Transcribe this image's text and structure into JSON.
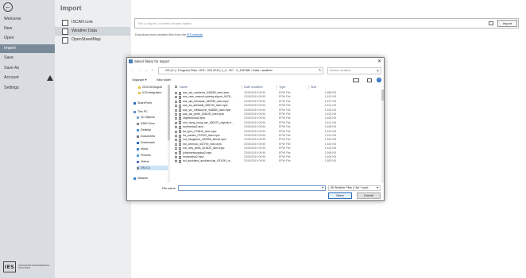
{
  "leftnav": {
    "items": [
      {
        "label": "Welcome"
      },
      {
        "label": "New"
      },
      {
        "label": "Open"
      },
      {
        "label": "Import"
      },
      {
        "label": "Save"
      },
      {
        "label": "Save As"
      },
      {
        "label": "Account"
      },
      {
        "label": "Settings"
      }
    ],
    "active": "Import",
    "logo_mark": "IES",
    "logo_text": "INTEGRATED ENVIRONMENTAL SOLUTIONS"
  },
  "page": {
    "title": "Import",
    "subnav": [
      {
        "label": "ISCAN Link"
      },
      {
        "label": "Weather Data"
      },
      {
        "label": "OpenStreetMap"
      }
    ],
    "path_placeholder": "File to import, or select browse button",
    "import_label": "Import",
    "download_prefix": "Download more weather files from the ",
    "download_link": "IES website"
  },
  "dialog": {
    "title": "Select file(s) for import",
    "address": "OS (C:)  ›  Program Files  ›  IES  ›  IVN 2019_1_0 - RC - 0_15278B  ›  Data  ›  weather",
    "search_placeholder": "Search weather",
    "organize_label": "Organize ▾",
    "new_folder_label": "New folder",
    "tree": [
      {
        "label": "2019-08 August"
      },
      {
        "label": "ICM integration"
      },
      {
        "label": "SharePoint"
      },
      {
        "label": "This PC"
      },
      {
        "label": "3D Objects"
      },
      {
        "label": "A380 Drive"
      },
      {
        "label": "Desktop"
      },
      {
        "label": "Documents"
      },
      {
        "label": "Downloads"
      },
      {
        "label": "Music"
      },
      {
        "label": "Pictures"
      },
      {
        "label": "Videos"
      },
      {
        "label": "OS (C:)"
      },
      {
        "label": "Network"
      }
    ],
    "columns": {
      "name": "Name",
      "date": "Date modified",
      "type": "Type",
      "size": "Size"
    },
    "files": [
      {
        "name": "aus_act_canberra_946260_iwec.epw",
        "date": "23/05/2019 09:50",
        "type": "EPW File",
        "size": "1,588 KB"
      },
      {
        "name": "aus_nsw_mascot-sydney.airport_9478...",
        "date": "23/05/2019 09:50",
        "type": "EPW File",
        "size": "1,610 KB"
      },
      {
        "name": "aus_qld_brisbane_945780_iwec.epw",
        "date": "23/05/2019 09:50",
        "type": "EPW File",
        "size": "1,537 KB"
      },
      {
        "name": "aus_sa_adelaide_946720_iwec.epw",
        "date": "23/05/2019 09:50",
        "type": "EPW File",
        "size": "1,514 KB"
      },
      {
        "name": "aus_vic_melbourne_948680_iwec.epw",
        "date": "23/05/2019 09:50",
        "type": "EPW File",
        "size": "1,534 KB"
      },
      {
        "name": "aus_wa_perth_946100_iwec.epw",
        "date": "23/05/2019 09:50",
        "type": "EPW File",
        "size": "1,523 KB"
      },
      {
        "name": "capetownsa2.epw",
        "date": "23/05/2019 09:50",
        "type": "EPW File",
        "size": "1,608 KB"
      },
      {
        "name": "chn_hong_kong_sar_450070_cityuhk.e...",
        "date": "23/05/2019 09:50",
        "type": "EPW File",
        "size": "1,631 KB"
      },
      {
        "name": "dunbardsa2.epw",
        "date": "23/05/2019 09:50",
        "type": "EPW File",
        "size": "1,598 KB"
      },
      {
        "name": "fra_lyon_074810_iwec.epw",
        "date": "23/05/2019 09:50",
        "type": "EPW File",
        "size": "1,510 KB"
      },
      {
        "name": "fra_nantes_072220_iwec.epw",
        "date": "23/05/2019 09:50",
        "type": "EPW File",
        "size": "1,510 KB"
      },
      {
        "name": "ind_bangalore_432950_ishrae.epw",
        "date": "23/05/2019 09:50",
        "type": "EPW File",
        "size": "1,543 KB"
      },
      {
        "name": "ind_chennai_432790_iwec.epw",
        "date": "23/05/2019 09:50",
        "type": "EPW File",
        "size": "1,525 KB"
      },
      {
        "name": "ind_new_delhi_421820_iwec.epw",
        "date": "23/05/2019 09:50",
        "type": "EPW File",
        "size": "1,513 KB"
      },
      {
        "name": "johannesburgdsa2.epw",
        "date": "23/05/2019 09:50",
        "type": "EPW File",
        "size": "1,598 KB"
      },
      {
        "name": "mosinadsa2.epw",
        "date": "23/05/2019 09:50",
        "type": "EPW File",
        "size": "1,608 KB"
      },
      {
        "name": "nzl_auckland_auckland.ap_931190_ni...",
        "date": "23/05/2019 09:50",
        "type": "EPW File",
        "size": "1,553 KB"
      }
    ],
    "filename_label": "File name:",
    "filename_value": "",
    "filetype_value": "All Weather Files (*.fwt *.epw)",
    "open_label": "Open",
    "cancel_label": "Cancel"
  }
}
